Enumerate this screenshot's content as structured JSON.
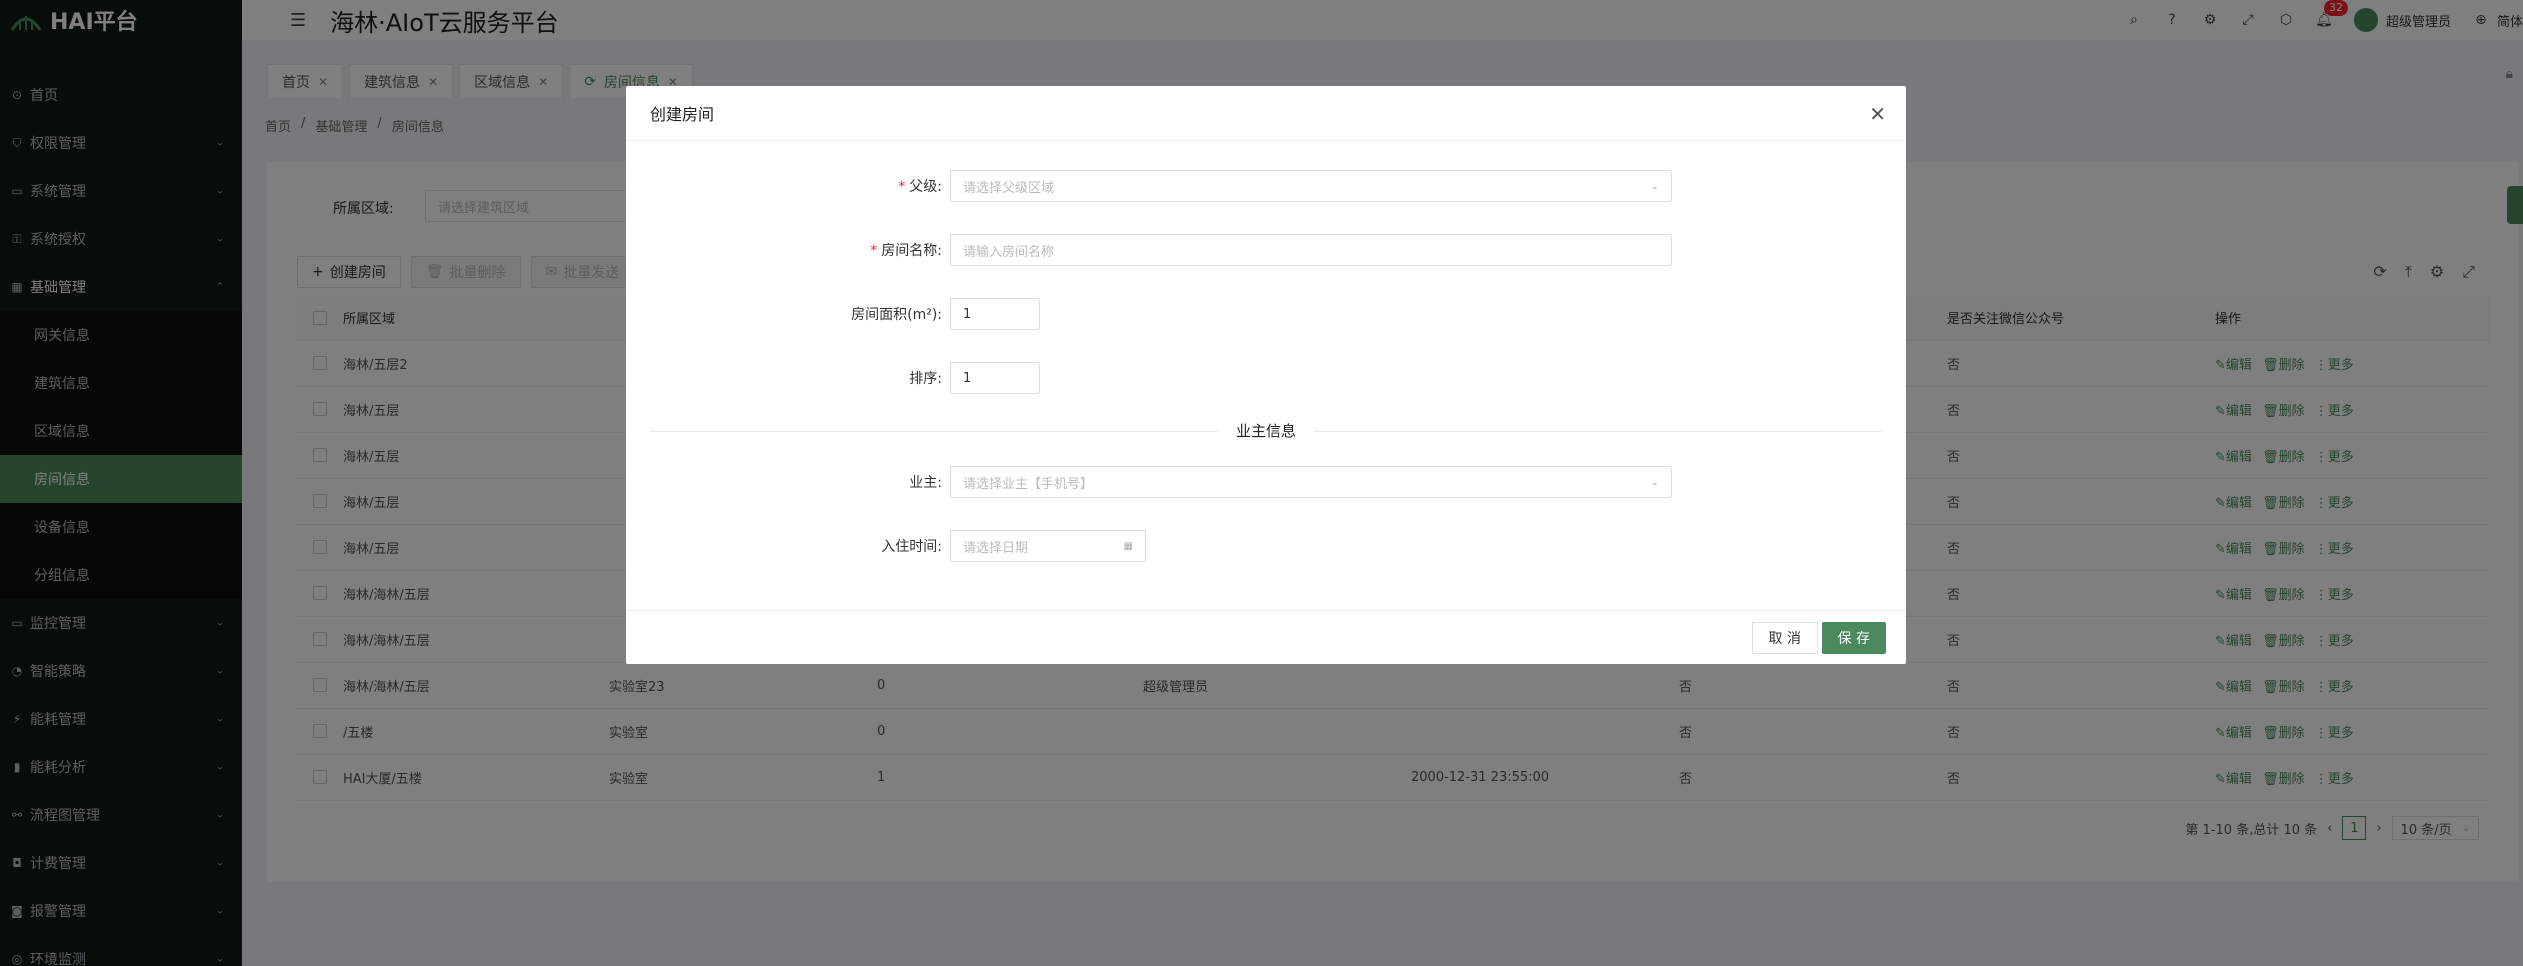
{
  "app": {
    "logo_text": "HAI平台",
    "header_title": "海林·AIoT云服务平台"
  },
  "header": {
    "user_name": "超级管理员",
    "lang": "简体",
    "notif_count": "32"
  },
  "sidebar": {
    "items": [
      {
        "label": "首页",
        "icon": "home-icon"
      },
      {
        "label": "权限管理",
        "icon": "shield-icon"
      },
      {
        "label": "系统管理",
        "icon": "monitor-icon"
      },
      {
        "label": "系统授权",
        "icon": "key-icon"
      },
      {
        "label": "基础管理",
        "icon": "grid-icon"
      }
    ],
    "sub_items": [
      "网关信息",
      "建筑信息",
      "区域信息",
      "房间信息",
      "设备信息",
      "分组信息"
    ],
    "items_after": [
      {
        "label": "监控管理",
        "icon": "monitor-icon"
      },
      {
        "label": "智能策略",
        "icon": "bulb-icon"
      },
      {
        "label": "能耗管理",
        "icon": "energy-icon"
      },
      {
        "label": "能耗分析",
        "icon": "chart-icon"
      },
      {
        "label": "流程图管理",
        "icon": "flow-icon"
      },
      {
        "label": "计费管理",
        "icon": "money-icon"
      },
      {
        "label": "报警管理",
        "icon": "alarm-icon"
      },
      {
        "label": "环境监测",
        "icon": "env-icon"
      }
    ]
  },
  "tabs": [
    "首页",
    "建筑信息",
    "区域信息",
    "房间信息"
  ],
  "breadcrumb": [
    "首页",
    "基础管理",
    "房间信息"
  ],
  "filter": {
    "label": "所属区域:",
    "placeholder": "请选择建筑区域"
  },
  "toolbar": {
    "create": "创建房间",
    "batch_delete": "批量删除",
    "batch_send": "批量发送"
  },
  "table": {
    "headers": [
      "所属区域",
      "是否关注微信公众号",
      "操作"
    ],
    "rows": [
      {
        "area": "海林/五层2",
        "name": "",
        "area_size": "",
        "owner": "",
        "checkin": "",
        "c1": "",
        "wechat": "否"
      },
      {
        "area": "海林/五层",
        "name": "",
        "area_size": "",
        "owner": "",
        "checkin": "",
        "c1": "",
        "wechat": "否"
      },
      {
        "area": "海林/五层",
        "name": "",
        "area_size": "",
        "owner": "",
        "checkin": "",
        "c1": "",
        "wechat": "否"
      },
      {
        "area": "海林/五层",
        "name": "",
        "area_size": "",
        "owner": "",
        "checkin": "",
        "c1": "",
        "wechat": "否"
      },
      {
        "area": "海林/五层",
        "name": "",
        "area_size": "",
        "owner": "",
        "checkin": "",
        "c1": "",
        "wechat": "否"
      },
      {
        "area": "海林/海林/五层",
        "name": "",
        "area_size": "",
        "owner": "",
        "checkin": "",
        "c1": "",
        "wechat": "否"
      },
      {
        "area": "海林/海林/五层",
        "name": "",
        "area_size": "",
        "owner": "",
        "checkin": "",
        "c1": "",
        "wechat": "否"
      },
      {
        "area": "海林/海林/五层",
        "name": "实验室23",
        "area_size": "0",
        "owner": "超级管理员",
        "checkin": "",
        "c1": "否",
        "wechat": "否"
      },
      {
        "area": "/五楼",
        "name": "实验室",
        "area_size": "0",
        "owner": "",
        "checkin": "",
        "c1": "否",
        "wechat": "否"
      },
      {
        "area": "HAI大厦/五楼",
        "name": "实验室",
        "area_size": "1",
        "owner": "",
        "checkin": "2000-12-31 23:55:00",
        "c1": "否",
        "wechat": "否"
      }
    ],
    "ops": {
      "edit": "编辑",
      "delete": "删除",
      "more": "更多"
    }
  },
  "pager": {
    "summary": "第 1-10 条,总计 10 条",
    "page": "1",
    "size": "10 条/页"
  },
  "dialog": {
    "title": "创建房间",
    "parent_label": "父级:",
    "parent_placeholder": "请选择父级区域",
    "name_label": "房间名称:",
    "name_placeholder": "请输入房间名称",
    "area_label": "房间面积(m²):",
    "area_value": "1",
    "sort_label": "排序:",
    "sort_value": "1",
    "section_title": "业主信息",
    "owner_label": "业主:",
    "owner_placeholder": "请选择业主【手机号】",
    "checkin_label": "入住时间:",
    "checkin_placeholder": "请选择日期",
    "cancel": "取 消",
    "save": "保 存"
  },
  "colors": {
    "accent": "#4a8a5c",
    "sidebar_bg": "#0f1a13",
    "danger": "#f5222d"
  }
}
